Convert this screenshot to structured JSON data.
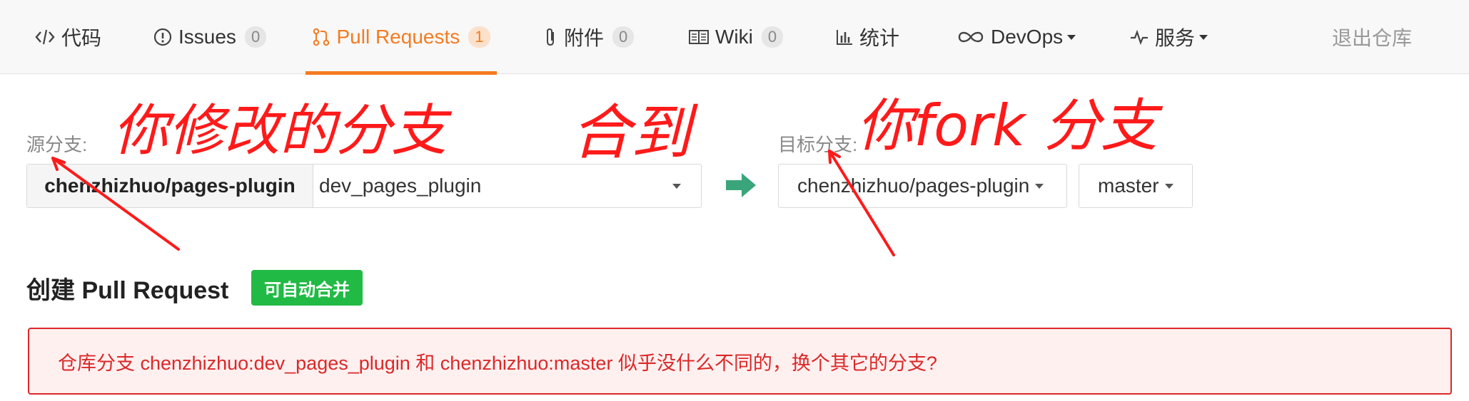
{
  "nav": {
    "tabs": [
      {
        "label": "代码",
        "icon": "code-icon"
      },
      {
        "label": "Issues",
        "icon": "alert-circle-icon",
        "count": "0"
      },
      {
        "label": "Pull Requests",
        "icon": "git-pull-request-icon",
        "count": "1",
        "active": true
      },
      {
        "label": "附件",
        "icon": "paperclip-icon",
        "count": "0"
      },
      {
        "label": "Wiki",
        "icon": "book-icon",
        "count": "0"
      },
      {
        "label": "统计",
        "icon": "bar-chart-icon"
      },
      {
        "label": "DevOps",
        "icon": "infinity-icon"
      },
      {
        "label": "服务",
        "icon": "pulse-icon"
      }
    ],
    "exit_label": "退出仓库"
  },
  "source": {
    "label": "源分支:",
    "repo": "chenzhizhuo/pages-plugin",
    "branch": "dev_pages_plugin"
  },
  "target": {
    "label": "目标分支:",
    "repo": "chenzhizhuo/pages-plugin",
    "branch": "master"
  },
  "pr": {
    "title": "创建 Pull Request",
    "badge": "可自动合并",
    "message": "仓库分支 chenzhizhuo:dev_pages_plugin 和 chenzhizhuo:master 似乎没什么不同的，换个其它的分支?"
  },
  "annotations": {
    "source_note": "你修改的分支",
    "merge_note": "合到",
    "target_note": "你fork 分支"
  },
  "colors": {
    "accent": "#f47b20",
    "success": "#21ba45",
    "error": "#db2828",
    "annotation": "#ff1a1a",
    "arrow": "#3aa57a"
  }
}
